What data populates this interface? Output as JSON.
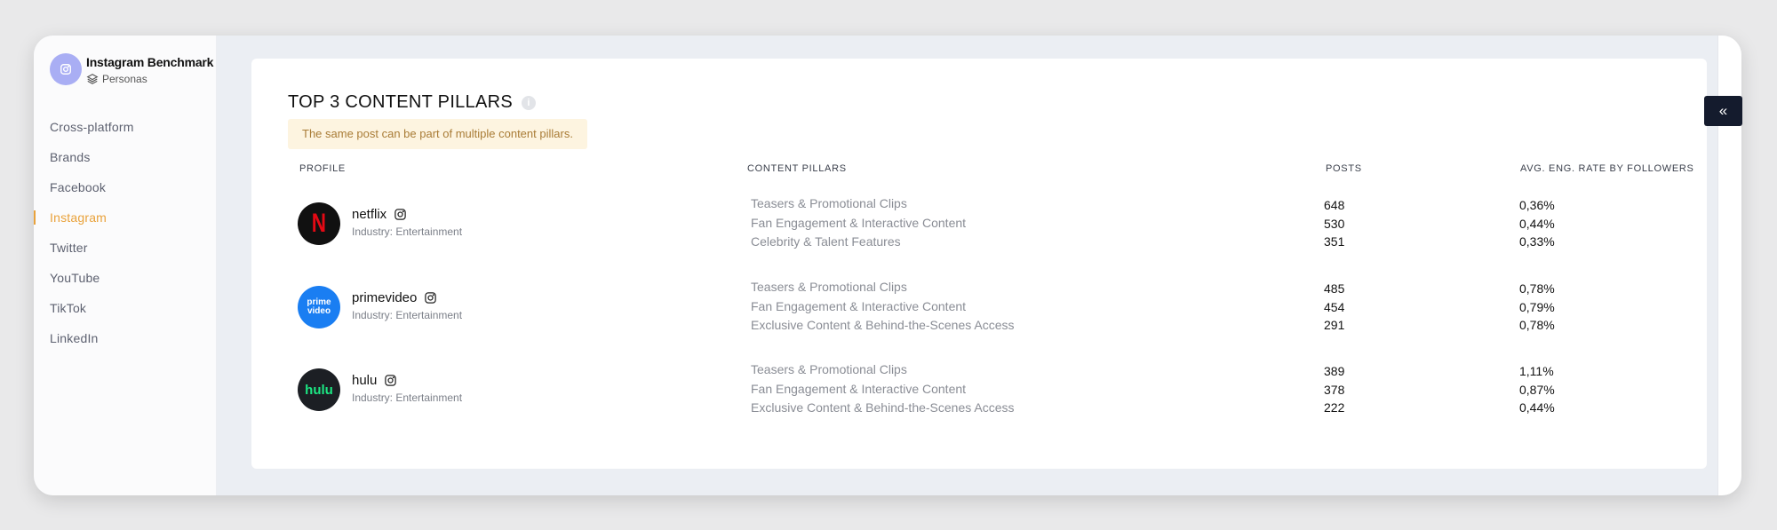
{
  "sidebar": {
    "title": "Instagram Benchmark",
    "subtitle": "Personas",
    "avatar_icon": "instagram-icon",
    "items": [
      {
        "label": "Cross-platform",
        "active": false
      },
      {
        "label": "Brands",
        "active": false
      },
      {
        "label": "Facebook",
        "active": false
      },
      {
        "label": "Instagram",
        "active": true
      },
      {
        "label": "Twitter",
        "active": false
      },
      {
        "label": "YouTube",
        "active": false
      },
      {
        "label": "TikTok",
        "active": false
      },
      {
        "label": "LinkedIn",
        "active": false
      }
    ]
  },
  "colors": {
    "accent": "#e9a23b",
    "sidebar_avatar": "#a9aef4",
    "collapse_button": "#141b2d",
    "note_bg": "#fdf4e0",
    "note_text": "#a97c36"
  },
  "main": {
    "title": "TOP 3 CONTENT PILLARS",
    "info_icon": "info-icon",
    "note": "The same post can be part of multiple content pillars.",
    "columns": {
      "profile": "PROFILE",
      "pillars": "CONTENT PILLARS",
      "posts": "POSTS",
      "rate": "AVG. ENG. RATE BY FOLLOWERS"
    },
    "rows": [
      {
        "name": "netflix",
        "industry": "Industry: Entertainment",
        "logo_text": "N",
        "logo_bg": "#111111",
        "logo_color": "#e50914",
        "pillars": [
          "Teasers & Promotional Clips",
          "Fan Engagement & Interactive Content",
          "Celebrity & Talent Features"
        ],
        "posts": [
          "648",
          "530",
          "351"
        ],
        "rates": [
          "0,36%",
          "0,44%",
          "0,33%"
        ]
      },
      {
        "name": "primevideo",
        "industry": "Industry: Entertainment",
        "logo_text": "prime video",
        "logo_bg": "#1a7ef2",
        "logo_color": "#ffffff",
        "pillars": [
          "Teasers & Promotional Clips",
          "Fan Engagement & Interactive Content",
          "Exclusive Content & Behind-the-Scenes Access"
        ],
        "posts": [
          "485",
          "454",
          "291"
        ],
        "rates": [
          "0,78%",
          "0,79%",
          "0,78%"
        ]
      },
      {
        "name": "hulu",
        "industry": "Industry: Entertainment",
        "logo_text": "hulu",
        "logo_bg": "#1c1f24",
        "logo_color": "#1ce783",
        "pillars": [
          "Teasers & Promotional Clips",
          "Fan Engagement & Interactive Content",
          "Exclusive Content & Behind-the-Scenes Access"
        ],
        "posts": [
          "389",
          "378",
          "222"
        ],
        "rates": [
          "1,11%",
          "0,87%",
          "0,44%"
        ]
      }
    ]
  },
  "collapse_button": {
    "label": "«"
  }
}
